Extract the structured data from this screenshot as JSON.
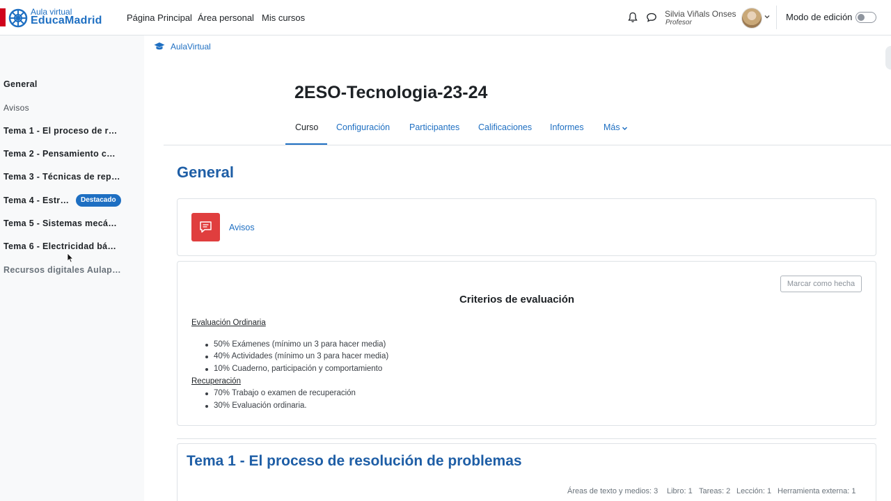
{
  "header": {
    "logo_top": "Aula virtual",
    "logo_bottom": "EducaMadrid",
    "nav": [
      "Página Principal",
      "Área personal",
      "Mis cursos"
    ],
    "user_name": "Silvia Viñals Onses",
    "user_role": "Profesor",
    "edit_mode_label": "Modo de edición",
    "edit_mode_on": false
  },
  "drawer": {
    "items": [
      "General",
      "Avisos",
      "Tema 1 - El proceso de r…",
      "Tema 2 - Pensamiento c…",
      "Tema 3 - Técnicas de rep…",
      "Tema 4 - Estr…",
      "Tema 5 - Sistemas mecá…",
      "Tema 6 - Electricidad bá…",
      "Recursos digitales Aulap…"
    ],
    "badge": "Destacado"
  },
  "main": {
    "breadcrumb": "AulaVirtual",
    "course_title": "2ESO-Tecnologia-23-24",
    "tabs": [
      "Curso",
      "Configuración",
      "Participantes",
      "Calificaciones",
      "Informes",
      "Más"
    ],
    "active_tab": "Curso",
    "section_title": "General",
    "avisos_label": "Avisos",
    "mark_done_label": "Marcar como hecha",
    "criteria": {
      "title": "Criterios de evaluación",
      "ordinaria_label": "Evaluación Ordinaria",
      "ordinaria_items": [
        "50% Exámenes (mínimo un 3 para hacer media)",
        "40% Actividades (mínimo un 3 para hacer media)",
        "10% Cuaderno, participación y comportamiento"
      ],
      "recuperacion_label": "Recuperación",
      "recuperacion_items": [
        "70% Trabajo o examen de recuperación",
        "30% Evaluación ordinaria."
      ]
    },
    "tema1_title": "Tema 1 - El proceso de resolución de problemas",
    "tema1_stats": [
      "Áreas de texto y medios: 3",
      "Libro: 1",
      "Tareas: 2",
      "Lección: 1",
      "Herramienta externa: 1"
    ]
  },
  "colors": {
    "brand_blue": "#1e6fc2",
    "section_blue": "#1e5ea6",
    "forum_red": "#e03e3e",
    "drawer_bg": "#f8f9fa"
  }
}
